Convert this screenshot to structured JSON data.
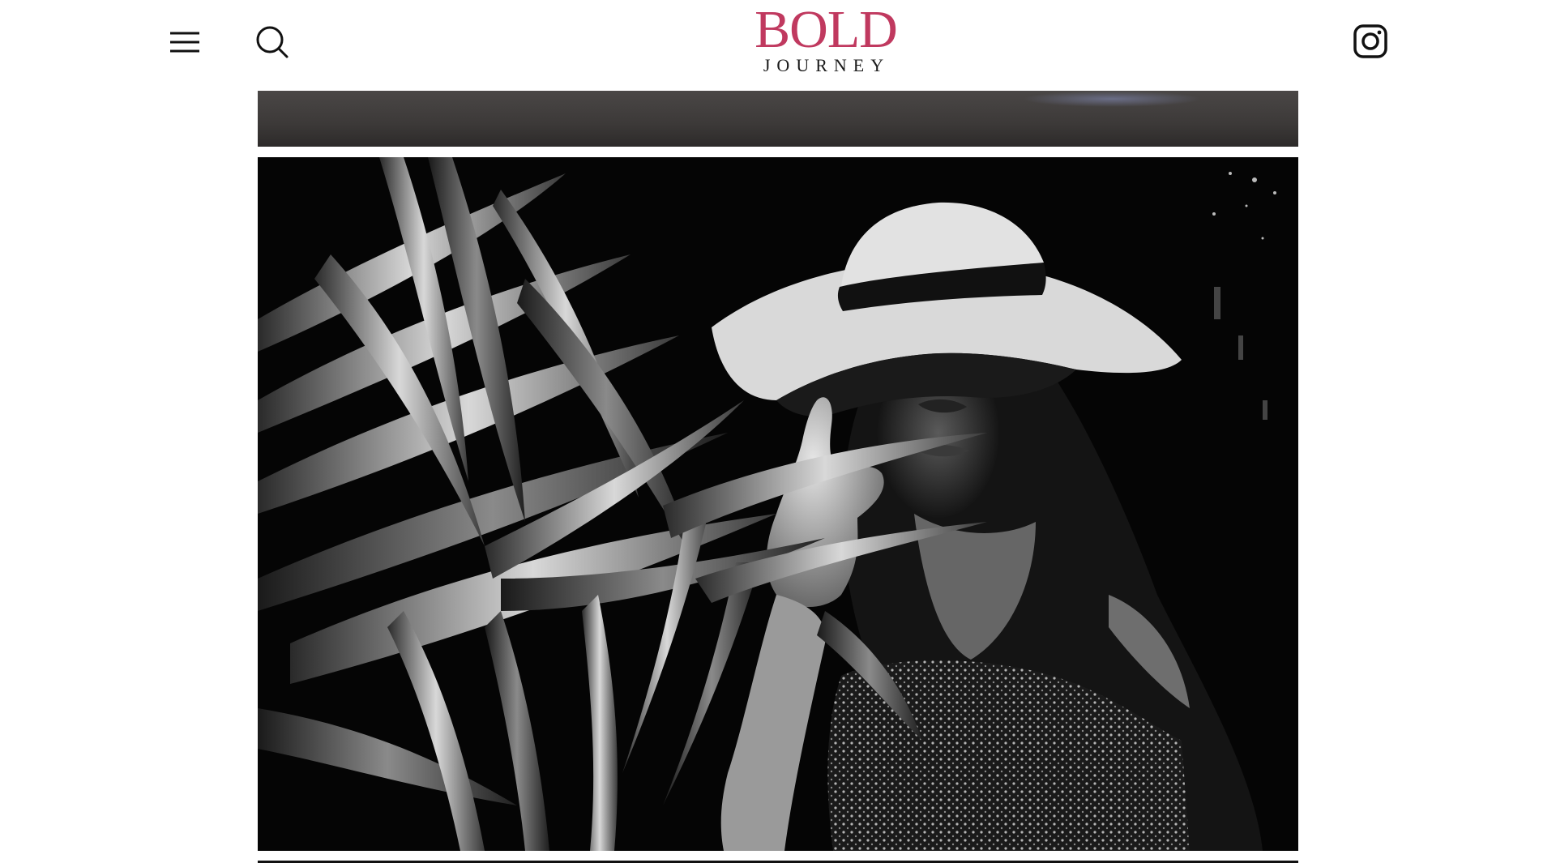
{
  "header": {
    "logo": {
      "line1": "BOLD",
      "line2": "JOURNEY",
      "color": "#c0395f"
    },
    "menu_icon": "hamburger-menu-icon",
    "search_icon": "search-icon",
    "instagram_icon": "instagram-icon"
  },
  "content": {
    "photos": [
      {
        "name": "previous-photo-partial",
        "tone": "grayscale"
      },
      {
        "name": "woman-in-sun-hat-among-palm-leaves",
        "tone": "black-and-white"
      }
    ]
  }
}
